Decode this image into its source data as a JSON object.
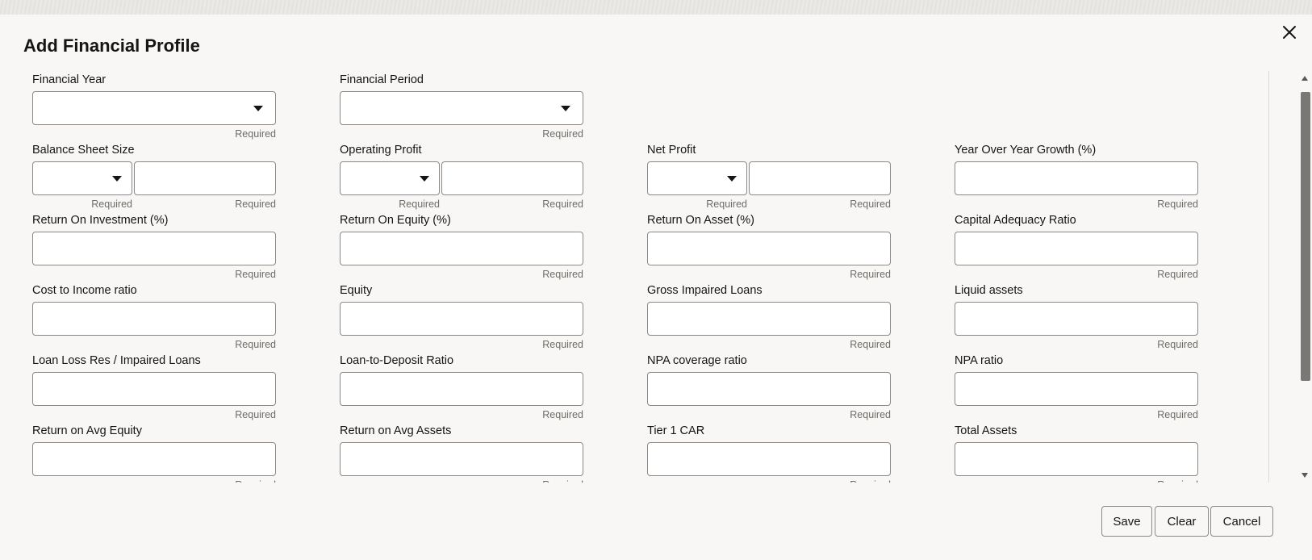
{
  "dialog": {
    "title": "Add Financial Profile",
    "close_icon": "close-icon"
  },
  "fields": [
    {
      "id": "financial-year",
      "label": "Financial Year",
      "type": "select",
      "required": "Required"
    },
    {
      "id": "financial-period",
      "label": "Financial Period",
      "type": "select",
      "required": "Required"
    },
    {
      "id": "empty-1",
      "type": "empty"
    },
    {
      "id": "empty-2",
      "type": "empty"
    },
    {
      "id": "balance-sheet-size",
      "label": "Balance Sheet Size",
      "type": "split",
      "required_left": "Required",
      "required": "Required"
    },
    {
      "id": "operating-profit",
      "label": "Operating Profit",
      "type": "split",
      "required_left": "Required",
      "required": "Required"
    },
    {
      "id": "net-profit",
      "label": "Net Profit",
      "type": "split",
      "required_left": "Required",
      "required": "Required"
    },
    {
      "id": "yoy-growth",
      "label": "Year Over Year Growth (%)",
      "type": "text",
      "required": "Required"
    },
    {
      "id": "roi",
      "label": "Return On Investment (%)",
      "type": "text",
      "required": "Required"
    },
    {
      "id": "roe",
      "label": "Return On Equity (%)",
      "type": "text",
      "required": "Required"
    },
    {
      "id": "roa",
      "label": "Return On Asset (%)",
      "type": "text",
      "required": "Required"
    },
    {
      "id": "car",
      "label": "Capital Adequacy Ratio",
      "type": "text",
      "required": "Required"
    },
    {
      "id": "cost-income",
      "label": "Cost to Income ratio",
      "type": "text",
      "required": "Required"
    },
    {
      "id": "equity",
      "label": "Equity",
      "type": "text",
      "required": "Required"
    },
    {
      "id": "gross-impaired-loans",
      "label": "Gross Impaired Loans",
      "type": "text",
      "required": "Required"
    },
    {
      "id": "liquid-assets",
      "label": "Liquid assets",
      "type": "text",
      "required": "Required"
    },
    {
      "id": "loan-loss-res",
      "label": "Loan Loss Res / Impaired Loans",
      "type": "text",
      "required": "Required"
    },
    {
      "id": "loan-to-deposit",
      "label": "Loan-to-Deposit Ratio",
      "type": "text",
      "required": "Required"
    },
    {
      "id": "npa-coverage",
      "label": "NPA coverage ratio",
      "type": "text",
      "required": "Required"
    },
    {
      "id": "npa-ratio",
      "label": "NPA ratio",
      "type": "text",
      "required": "Required"
    },
    {
      "id": "return-avg-equity",
      "label": "Return on Avg Equity",
      "type": "text",
      "required": "Required"
    },
    {
      "id": "return-avg-assets",
      "label": "Return on Avg Assets",
      "type": "text",
      "required": "Required"
    },
    {
      "id": "tier1-car",
      "label": "Tier 1 CAR",
      "type": "text",
      "required": "Required"
    },
    {
      "id": "total-assets",
      "label": "Total Assets",
      "type": "text",
      "required": "Required"
    }
  ],
  "buttons": {
    "save": "Save",
    "clear": "Clear",
    "cancel": "Cancel"
  },
  "colors": {
    "background": "#f8f7f5",
    "border": "#8b8885",
    "required_text": "#6f6c68",
    "scroll_thumb": "#7a7875"
  }
}
